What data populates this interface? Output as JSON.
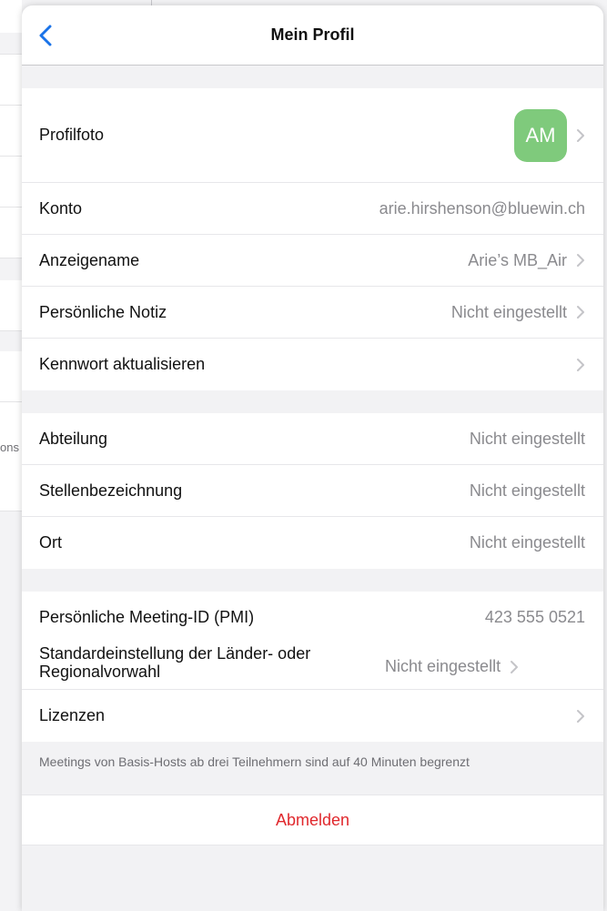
{
  "background": {
    "fragment_text": "ons"
  },
  "header": {
    "title": "Mein Profil",
    "back_icon": "chevron-left-icon"
  },
  "profile": {
    "photo_label": "Profilfoto",
    "avatar_initials": "AM",
    "avatar_color": "#7fca7c",
    "account_label": "Konto",
    "account_value": "arie.hirshenson@bluewin.ch",
    "display_name_label": "Anzeigename",
    "display_name_value": "Arie’s MB_Air",
    "personal_note_label": "Persönliche Notiz",
    "personal_note_value": "Nicht eingestellt",
    "password_label": "Kennwort aktualisieren"
  },
  "work": {
    "department_label": "Abteilung",
    "department_value": "Nicht eingestellt",
    "job_title_label": "Stellenbezeichnung",
    "job_title_value": "Nicht eingestellt",
    "location_label": "Ort",
    "location_value": "Nicht eingestellt"
  },
  "meeting": {
    "pmi_label": "Persönliche Meeting-ID (PMI)",
    "pmi_value": "423 555 0521",
    "region_label": "Standardeinstellung der Länder- oder Regionalvorwahl",
    "region_value": "Nicht eingestellt",
    "licenses_label": "Lizenzen"
  },
  "footer_note": "Meetings von Basis-Hosts ab drei Teilnehmern sind auf 40 Minuten begrenzt",
  "logout_label": "Abmelden",
  "colors": {
    "accent_blue": "#1a73e8",
    "logout_red": "#e0282d"
  }
}
